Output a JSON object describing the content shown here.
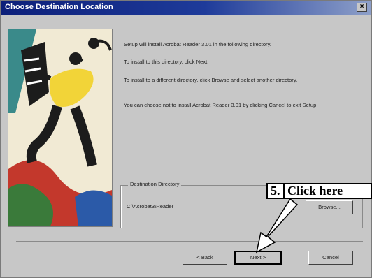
{
  "window": {
    "title": "Choose Destination Location",
    "close_glyph": "×"
  },
  "body_text": [
    "Setup will install Acrobat Reader 3.01 in the following directory.",
    "To install to this directory, click Next.",
    "To install to a different directory, click Browse and select another directory.",
    "You can choose not to install Acrobat Reader 3.01 by clicking Cancel to exit Setup."
  ],
  "destination": {
    "group_label": "Destination Directory",
    "path": "C:\\Acrobat3\\Reader",
    "browse_label": "Browse..."
  },
  "buttons": {
    "back": "< Back",
    "next": "Next >",
    "cancel": "Cancel"
  },
  "callout": {
    "step": "5.",
    "text": "Click here"
  },
  "colors": {
    "title_bar": "#0c1f7a",
    "dialog_bg": "#c7c7c7",
    "callout_bg": "#ffffff"
  },
  "icons": [
    "close-icon",
    "arrow-pointer-icon"
  ]
}
